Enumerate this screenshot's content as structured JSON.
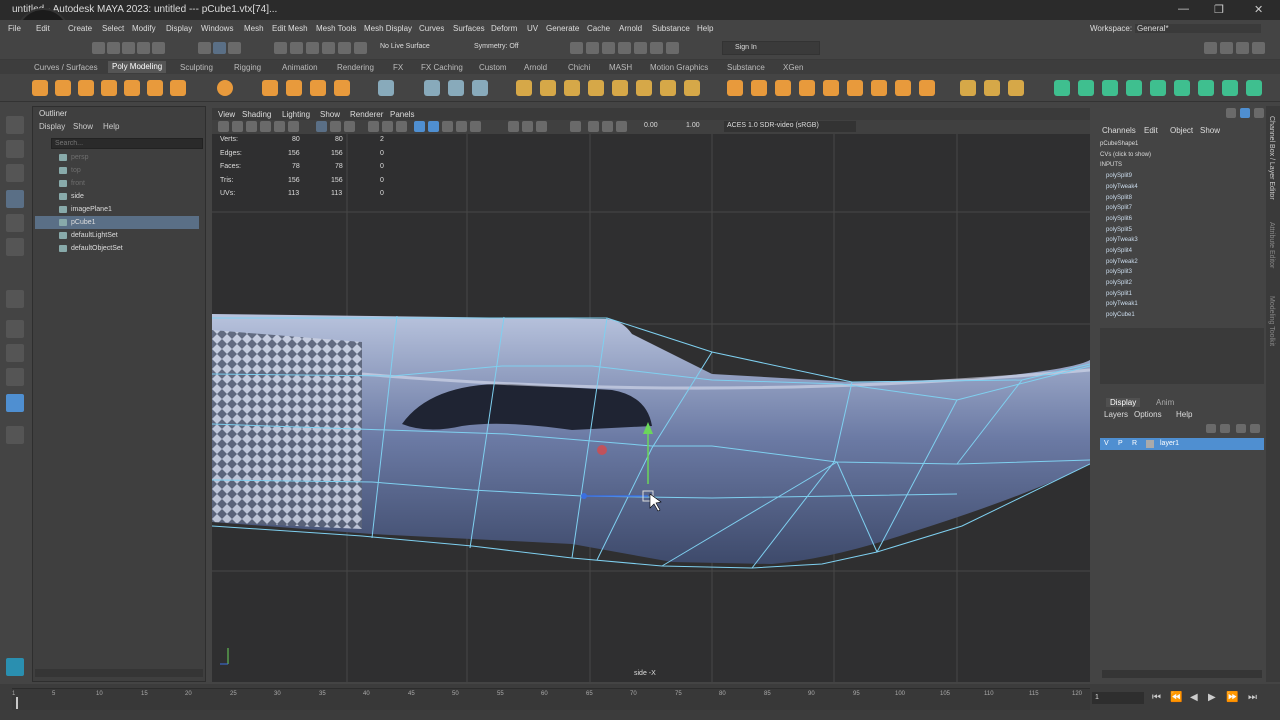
{
  "titlebar": {
    "title": "untitled - Autodesk MAYA 2023: untitled  ---  pCube1.vtx[74]...",
    "minimize": "—",
    "restore": "❐",
    "close": "✕"
  },
  "menus": [
    "File",
    "Edit",
    "Create",
    "Select",
    "Modify",
    "Display",
    "Windows",
    "Mesh",
    "Edit Mesh",
    "Mesh Tools",
    "Mesh Display",
    "Curves",
    "Surfaces",
    "Deform",
    "UV",
    "Generate",
    "Cache",
    "Arnold",
    "Substance",
    "Help"
  ],
  "workspace": {
    "label": "Workspace:",
    "value": "General*"
  },
  "status_line": {
    "no_live_surface": "No Live Surface",
    "symmetry": "Symmetry: Off",
    "sign_in": "Sign In"
  },
  "shelf_tabs": [
    "Curves / Surfaces",
    "Poly Modeling",
    "Sculpting",
    "Rigging",
    "Animation",
    "Rendering",
    "FX",
    "FX Caching",
    "Custom",
    "Arnold",
    "Chichi",
    "MASH",
    "Motion Graphics",
    "Substance",
    "XGen"
  ],
  "shelf_active": "Poly Modeling",
  "outliner": {
    "title": "Outliner",
    "menu": [
      "Display",
      "Show",
      "Help"
    ],
    "search_placeholder": "Search...",
    "items": [
      {
        "label": "persp",
        "dim": true
      },
      {
        "label": "top",
        "dim": true
      },
      {
        "label": "front",
        "dim": true
      },
      {
        "label": "side",
        "dim": false
      },
      {
        "label": "imagePlane1",
        "dim": false
      },
      {
        "label": "pCube1",
        "dim": false,
        "selected": true
      },
      {
        "label": "defaultLightSet",
        "dim": false
      },
      {
        "label": "defaultObjectSet",
        "dim": false
      }
    ]
  },
  "viewport": {
    "menu": [
      "View",
      "Shading",
      "Lighting",
      "Show",
      "Renderer",
      "Panels"
    ],
    "field_a": "0.00",
    "field_b": "1.00",
    "color_space": "ACES 1.0 SDR-video (sRGB)",
    "camera_label": "side -X",
    "hud": [
      {
        "label": "Verts:",
        "v1": "80",
        "v2": "80",
        "v3": "2"
      },
      {
        "label": "Edges:",
        "v1": "156",
        "v2": "156",
        "v3": "0"
      },
      {
        "label": "Faces:",
        "v1": "78",
        "v2": "78",
        "v3": "0"
      },
      {
        "label": "Tris:",
        "v1": "156",
        "v2": "156",
        "v3": "0"
      },
      {
        "label": "UVs:",
        "v1": "113",
        "v2": "113",
        "v3": "0"
      }
    ]
  },
  "channel_box": {
    "menu": [
      "Channels",
      "Edit",
      "Object",
      "Show"
    ],
    "shape": "pCubeShape1",
    "cvs": "CVs (click to show)",
    "inputs_header": "INPUTS",
    "inputs": [
      "polySplit9",
      "polyTweak4",
      "polySplit8",
      "polySplit7",
      "polySplit6",
      "polySplit5",
      "polyTweak3",
      "polySplit4",
      "polyTweak2",
      "polySplit3",
      "polySplit2",
      "polySplit1",
      "polyTweak1",
      "polyCube1"
    ]
  },
  "layer_editor": {
    "tabs": [
      "Display",
      "Anim"
    ],
    "menu": [
      "Layers",
      "Options",
      "Help"
    ],
    "layer": {
      "v": "V",
      "p": "P",
      "r": "R",
      "name": "layer1"
    }
  },
  "side_tabs": [
    "Channel Box / Layer Editor",
    "Attribute Editor",
    "Modeling Toolkit"
  ],
  "timeline": {
    "ticks": [
      "1",
      "5",
      "10",
      "15",
      "20",
      "25",
      "30",
      "35",
      "40",
      "45",
      "50",
      "55",
      "60",
      "65",
      "70",
      "75",
      "80",
      "85",
      "90",
      "95",
      "100",
      "105",
      "110",
      "115",
      "120"
    ],
    "current_frame": "1",
    "controls": [
      "⏮",
      "⏪",
      "◀",
      "▶",
      "⏩",
      "⏭"
    ]
  },
  "colors": {
    "accent": "#5a6f86",
    "selection_blue": "#4f8fd1",
    "wire": "#7fd0f0"
  }
}
